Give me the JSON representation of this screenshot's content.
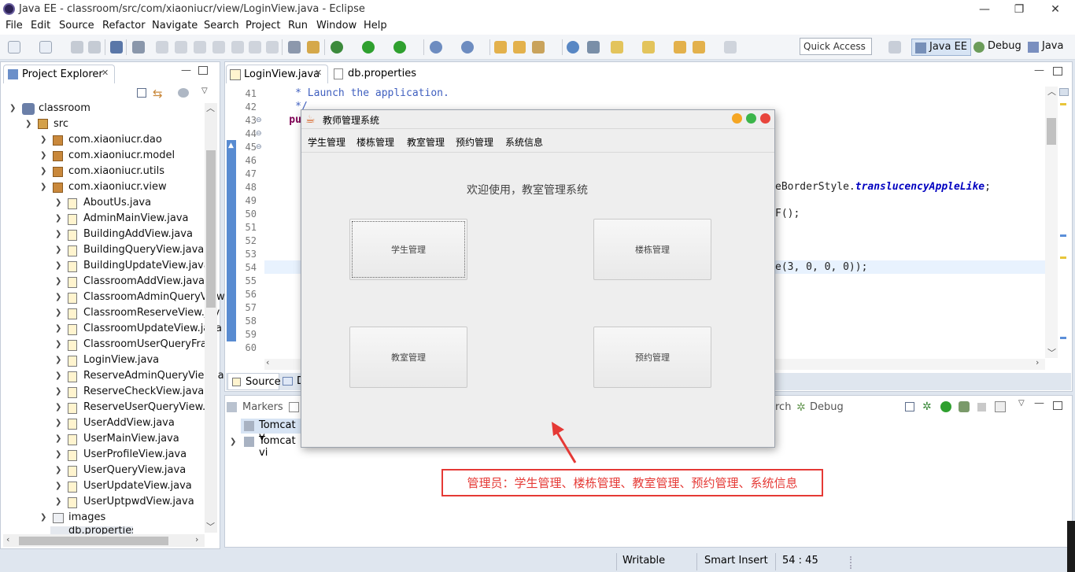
{
  "window": {
    "title": "Java EE - classroom/src/com/xiaoniucr/view/LoginView.java - Eclipse",
    "min": "—",
    "max": "❐",
    "close": "✕"
  },
  "menubar": [
    "File",
    "Edit",
    "Source",
    "Refactor",
    "Navigate",
    "Search",
    "Project",
    "Run",
    "Window",
    "Help"
  ],
  "quick_access": {
    "placeholder": "Quick Access"
  },
  "perspectives": [
    "Java EE",
    "Debug",
    "Java"
  ],
  "project_explorer": {
    "tab": "Project Explorer",
    "project": "classroom",
    "src": "src",
    "packages": [
      "com.xiaoniucr.dao",
      "com.xiaoniucr.model",
      "com.xiaoniucr.utils",
      "com.xiaoniucr.view"
    ],
    "files": [
      "AboutUs.java",
      "AdminMainView.java",
      "BuildingAddView.java",
      "BuildingQueryView.java",
      "BuildingUpdateView.java",
      "ClassroomAddView.java",
      "ClassroomAdminQueryView",
      "ClassroomReserveView.jav",
      "ClassroomUpdateView.java",
      "ClassroomUserQueryFram",
      "LoginView.java",
      "ReserveAdminQueryView.ja",
      "ReserveCheckView.java",
      "ReserveUserQueryView.ja",
      "UserAddView.java",
      "UserMainView.java",
      "UserProfileView.java",
      "UserQueryView.java",
      "UserUpdateView.java",
      "UserUptpwdView.java"
    ],
    "images": "images",
    "last": "db.properties"
  },
  "editor": {
    "tabs": [
      "LoginView.java",
      "db.properties"
    ],
    "line_numbers": [
      "41",
      "42",
      "43",
      "44",
      "45",
      "46",
      "47",
      "48",
      "49",
      "50",
      "51",
      "52",
      "53",
      "54",
      "55",
      "56",
      "57",
      "58",
      "59",
      "60"
    ],
    "code": {
      "l41": "     * Launch the application.",
      "l42": "     */",
      "l43": "    pu",
      "l48_tail": "eBorderStyle.",
      "l48_italic": "translucencyAppleLike",
      "l48_end": ";",
      "l50_tail": "F();",
      "l54_tail": "e(3, 0, 0, 0));"
    },
    "bottom_tabs": [
      "Source",
      "D"
    ]
  },
  "bottom_panel": {
    "tabs": [
      "Markers",
      "rch",
      "Debug"
    ],
    "items": [
      "Tomcat v",
      "Tomcat vi"
    ]
  },
  "status": {
    "writable": "Writable",
    "insert": "Smart Insert",
    "position": "54 : 45"
  },
  "dialog": {
    "title": "教师管理系统",
    "menu": [
      "学生管理",
      "楼栋管理",
      "教室管理",
      "预约管理",
      "系统信息"
    ],
    "welcome": "欢迎使用，教室管理系统",
    "buttons": [
      "学生管理",
      "楼栋管理",
      "教室管理",
      "预约管理"
    ]
  },
  "annotation": "管理员：学生管理、楼栋管理、教室管理、预约管理、系统信息",
  "colors": {
    "accent_red": "#e53935",
    "light_orange": "#f5a623",
    "light_green": "#3cb54a",
    "light_red": "#e8453c"
  }
}
